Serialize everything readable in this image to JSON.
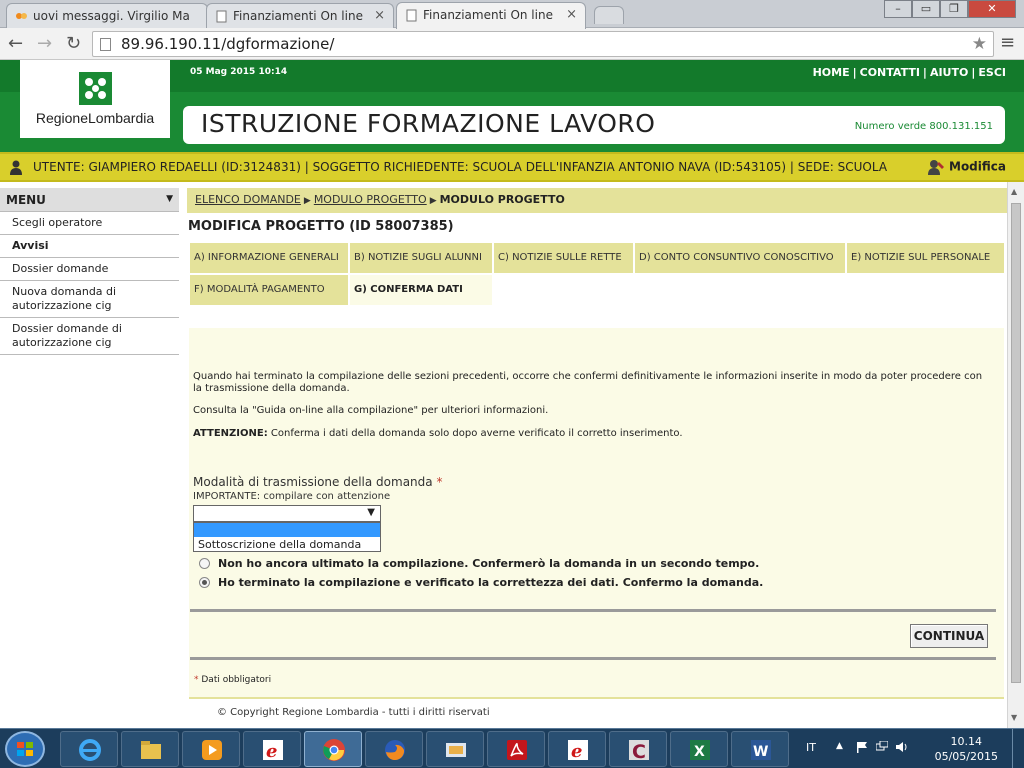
{
  "browser": {
    "tabs": [
      {
        "label": "uovi messaggi. Virgilio Ma",
        "active": false
      },
      {
        "label": "Finanziamenti On line",
        "active": false
      },
      {
        "label": "Finanziamenti On line",
        "active": true
      }
    ],
    "url": "89.96.190.11/dgformazione/"
  },
  "header": {
    "logo_text": "RegioneLombardia",
    "datetime": "05 Mag 2015 10:14",
    "links": [
      "HOME",
      "CONTATTI",
      "AIUTO",
      "ESCI"
    ],
    "title": "ISTRUZIONE FORMAZIONE LAVORO",
    "numero_verde": "Numero verde 800.131.151",
    "brand_color": "#1a8a34"
  },
  "userbar": {
    "text": "UTENTE: GIAMPIERO REDAELLI (ID:3124831)  |  SOGGETTO RICHIEDENTE: SCUOLA DELL'INFANZIA ANTONIO NAVA (ID:543105)  |  SEDE: SCUOLA",
    "modify_label": "Modifica"
  },
  "menu": {
    "title": "MENU",
    "items": [
      {
        "label": "Scegli operatore",
        "bold": false
      },
      {
        "label": "Avvisi",
        "bold": true
      },
      {
        "label": "Dossier domande",
        "bold": false
      },
      {
        "label": "Nuova domanda di autorizzazione cig",
        "bold": false
      },
      {
        "label": "Dossier domande di autorizzazione cig",
        "bold": false
      }
    ]
  },
  "breadcrumb": {
    "items": [
      "ELENCO DOMANDE",
      "MODULO PROGETTO"
    ],
    "current": "MODULO PROGETTO"
  },
  "page_title": "MODIFICA PROGETTO (ID 58007385)",
  "sections": [
    {
      "label": "A) INFORMAZIONE GENERALI"
    },
    {
      "label": "B) NOTIZIE SUGLI ALUNNI"
    },
    {
      "label": "C) NOTIZIE SULLE RETTE"
    },
    {
      "label": "D) CONTO CONSUNTIVO CONOSCITIVO"
    },
    {
      "label": "E) NOTIZIE SUL PERSONALE"
    },
    {
      "label": "F) MODALITÀ PAGAMENTO"
    },
    {
      "label": "G) CONFERMA DATI",
      "active": true
    }
  ],
  "content": {
    "intro": "Quando hai terminato la compilazione delle sezioni precedenti, occorre che confermi definitivamente le informazioni inserite in modo da poter procedere con la trasmissione della domanda.",
    "guide": "Consulta la \"Guida on-line alla compilazione\" per ulteriori informazioni.",
    "warning_label": "ATTENZIONE:",
    "warning_text": " Conferma i dati della domanda solo dopo averne verificato il corretto inserimento.",
    "dropdown_label": "Modalità di trasmissione della domanda",
    "required_mark": "*",
    "dropdown_hint": "IMPORTANTE: compilare con attenzione",
    "dropdown_value": "",
    "dropdown_options": [
      "",
      "Sottoscrizione della domanda"
    ],
    "radio_options": [
      {
        "label": "Non ho ancora ultimato la compilazione. Confermerò la domanda in un secondo tempo.",
        "selected": false
      },
      {
        "label": "Ho terminato la compilazione e verificato la correttezza dei dati. Confermo la domanda.",
        "selected": true
      }
    ],
    "continue_button": "CONTINUA",
    "required_note": "Dati obbligatori"
  },
  "footer": {
    "copyright": "© Copyright Regione Lombardia - tutti i diritti riservati"
  },
  "taskbar": {
    "lang": "IT",
    "time": "10.14",
    "date": "05/05/2015",
    "apps": [
      "ie-icon",
      "explorer-icon",
      "media-player-icon",
      "e-app-icon",
      "chrome-icon",
      "firefox-icon",
      "scanner-icon",
      "acrobat-icon",
      "e-app-icon",
      "c-app-icon",
      "excel-icon",
      "word-icon"
    ]
  }
}
